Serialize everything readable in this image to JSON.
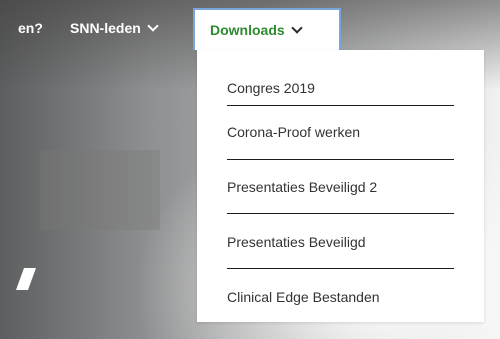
{
  "nav": {
    "partial_item": "en?",
    "items": [
      {
        "label": "SNN-leden"
      }
    ],
    "active": {
      "label": "Downloads"
    }
  },
  "dropdown": {
    "items": [
      {
        "label": "Congres 2019"
      },
      {
        "label": "Corona-Proof werken"
      },
      {
        "label": "Presentaties Beveiligd 2"
      },
      {
        "label": "Presentaties Beveiligd"
      },
      {
        "label": "Clinical Edge Bestanden"
      }
    ]
  },
  "colors": {
    "accent_green": "#2e8b30",
    "focus_border": "#7aa4dc",
    "dropdown_text": "#333333"
  }
}
